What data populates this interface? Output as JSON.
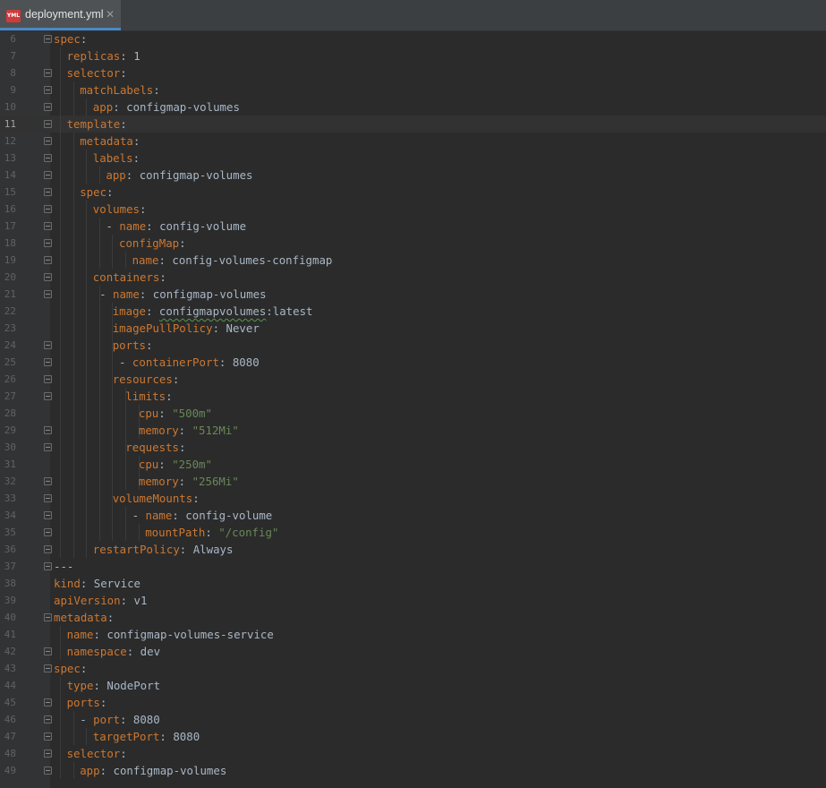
{
  "tab": {
    "title": "deployment.yml",
    "icon": "yml-file-icon",
    "icon_label": "YML",
    "close": "✕"
  },
  "colors": {
    "background": "#2b2b2b",
    "key": "#cc7832",
    "string": "#6a8759",
    "text": "#a9b7c6"
  },
  "current_line": 11,
  "lines": [
    {
      "n": "6",
      "indent": 0,
      "dash": false,
      "key": "spec",
      "value": "",
      "type": "plain",
      "fold": true
    },
    {
      "n": "7",
      "indent": 1,
      "dash": false,
      "key": "replicas",
      "value": "1",
      "type": "plain",
      "fold": false
    },
    {
      "n": "8",
      "indent": 1,
      "dash": false,
      "key": "selector",
      "value": "",
      "type": "plain",
      "fold": true
    },
    {
      "n": "9",
      "indent": 2,
      "dash": false,
      "key": "matchLabels",
      "value": "",
      "type": "plain",
      "fold": true
    },
    {
      "n": "10",
      "indent": 3,
      "dash": false,
      "key": "app",
      "value": "configmap-volumes",
      "type": "plain",
      "fold": true
    },
    {
      "n": "11",
      "indent": 1,
      "dash": false,
      "key": "template",
      "value": "",
      "type": "plain",
      "fold": true
    },
    {
      "n": "12",
      "indent": 2,
      "dash": false,
      "key": "metadata",
      "value": "",
      "type": "plain",
      "fold": true
    },
    {
      "n": "13",
      "indent": 3,
      "dash": false,
      "key": "labels",
      "value": "",
      "type": "plain",
      "fold": true
    },
    {
      "n": "14",
      "indent": 4,
      "dash": false,
      "key": "app",
      "value": "configmap-volumes",
      "type": "plain",
      "fold": true
    },
    {
      "n": "15",
      "indent": 2,
      "dash": false,
      "key": "spec",
      "value": "",
      "type": "plain",
      "fold": true
    },
    {
      "n": "16",
      "indent": 3,
      "dash": false,
      "key": "volumes",
      "value": "",
      "type": "plain",
      "fold": true
    },
    {
      "n": "17",
      "indent": 4,
      "dash": true,
      "key": "name",
      "value": "config-volume",
      "type": "plain",
      "fold": true
    },
    {
      "n": "18",
      "indent": 5,
      "dash": false,
      "key": "configMap",
      "value": "",
      "type": "plain",
      "fold": true
    },
    {
      "n": "19",
      "indent": 6,
      "dash": false,
      "key": "name",
      "value": "config-volumes-configmap",
      "type": "plain",
      "fold": true
    },
    {
      "n": "20",
      "indent": 3,
      "dash": false,
      "key": "containers",
      "value": "",
      "type": "plain",
      "fold": true
    },
    {
      "n": "21",
      "indent": 3.5,
      "dash": true,
      "key": "name",
      "value": "configmap-volumes",
      "type": "plain",
      "fold": true
    },
    {
      "n": "22",
      "indent": 4.5,
      "dash": false,
      "key": "image",
      "value": "configmapvolumes:latest",
      "type": "squiggle",
      "fold": false
    },
    {
      "n": "23",
      "indent": 4.5,
      "dash": false,
      "key": "imagePullPolicy",
      "value": "Never",
      "type": "plain",
      "fold": false
    },
    {
      "n": "24",
      "indent": 4.5,
      "dash": false,
      "key": "ports",
      "value": "",
      "type": "plain",
      "fold": true
    },
    {
      "n": "25",
      "indent": 5,
      "dash": true,
      "key": "containerPort",
      "value": "8080",
      "type": "plain",
      "fold": true
    },
    {
      "n": "26",
      "indent": 4.5,
      "dash": false,
      "key": "resources",
      "value": "",
      "type": "plain",
      "fold": true
    },
    {
      "n": "27",
      "indent": 5.5,
      "dash": false,
      "key": "limits",
      "value": "",
      "type": "plain",
      "fold": true
    },
    {
      "n": "28",
      "indent": 6.5,
      "dash": false,
      "key": "cpu",
      "value": "\"500m\"",
      "type": "string",
      "fold": false
    },
    {
      "n": "29",
      "indent": 6.5,
      "dash": false,
      "key": "memory",
      "value": "\"512Mi\"",
      "type": "string",
      "fold": true
    },
    {
      "n": "30",
      "indent": 5.5,
      "dash": false,
      "key": "requests",
      "value": "",
      "type": "plain",
      "fold": true
    },
    {
      "n": "31",
      "indent": 6.5,
      "dash": false,
      "key": "cpu",
      "value": "\"250m\"",
      "type": "string",
      "fold": false
    },
    {
      "n": "32",
      "indent": 6.5,
      "dash": false,
      "key": "memory",
      "value": "\"256Mi\"",
      "type": "string",
      "fold": true
    },
    {
      "n": "33",
      "indent": 4.5,
      "dash": false,
      "key": "volumeMounts",
      "value": "",
      "type": "plain",
      "fold": true
    },
    {
      "n": "34",
      "indent": 6,
      "dash": true,
      "key": "name",
      "value": "config-volume",
      "type": "plain",
      "fold": true
    },
    {
      "n": "35",
      "indent": 7,
      "dash": false,
      "key": "mountPath",
      "value": "\"/config\"",
      "type": "string",
      "fold": true
    },
    {
      "n": "36",
      "indent": 3,
      "dash": false,
      "key": "restartPolicy",
      "value": "Always",
      "type": "plain",
      "fold": true
    },
    {
      "n": "37",
      "indent": 0,
      "dash": false,
      "key": "",
      "value": "---",
      "type": "sep",
      "fold": true
    },
    {
      "n": "38",
      "indent": 0,
      "dash": false,
      "key": "kind",
      "value": "Service",
      "type": "plain",
      "fold": false
    },
    {
      "n": "39",
      "indent": 0,
      "dash": false,
      "key": "apiVersion",
      "value": "v1",
      "type": "plain",
      "fold": false
    },
    {
      "n": "40",
      "indent": 0,
      "dash": false,
      "key": "metadata",
      "value": "",
      "type": "plain",
      "fold": true
    },
    {
      "n": "41",
      "indent": 1,
      "dash": false,
      "key": "name",
      "value": "configmap-volumes-service",
      "type": "plain",
      "fold": false
    },
    {
      "n": "42",
      "indent": 1,
      "dash": false,
      "key": "namespace",
      "value": "dev",
      "type": "plain",
      "fold": true
    },
    {
      "n": "43",
      "indent": 0,
      "dash": false,
      "key": "spec",
      "value": "",
      "type": "plain",
      "fold": true
    },
    {
      "n": "44",
      "indent": 1,
      "dash": false,
      "key": "type",
      "value": "NodePort",
      "type": "plain",
      "fold": false
    },
    {
      "n": "45",
      "indent": 1,
      "dash": false,
      "key": "ports",
      "value": "",
      "type": "plain",
      "fold": true
    },
    {
      "n": "46",
      "indent": 2,
      "dash": true,
      "key": "port",
      "value": "8080",
      "type": "plain",
      "fold": true
    },
    {
      "n": "47",
      "indent": 3,
      "dash": false,
      "key": "targetPort",
      "value": "8080",
      "type": "plain",
      "fold": true
    },
    {
      "n": "48",
      "indent": 1,
      "dash": false,
      "key": "selector",
      "value": "",
      "type": "plain",
      "fold": true
    },
    {
      "n": "49",
      "indent": 2,
      "dash": false,
      "key": "app",
      "value": "configmap-volumes",
      "type": "plain",
      "fold": true
    }
  ]
}
